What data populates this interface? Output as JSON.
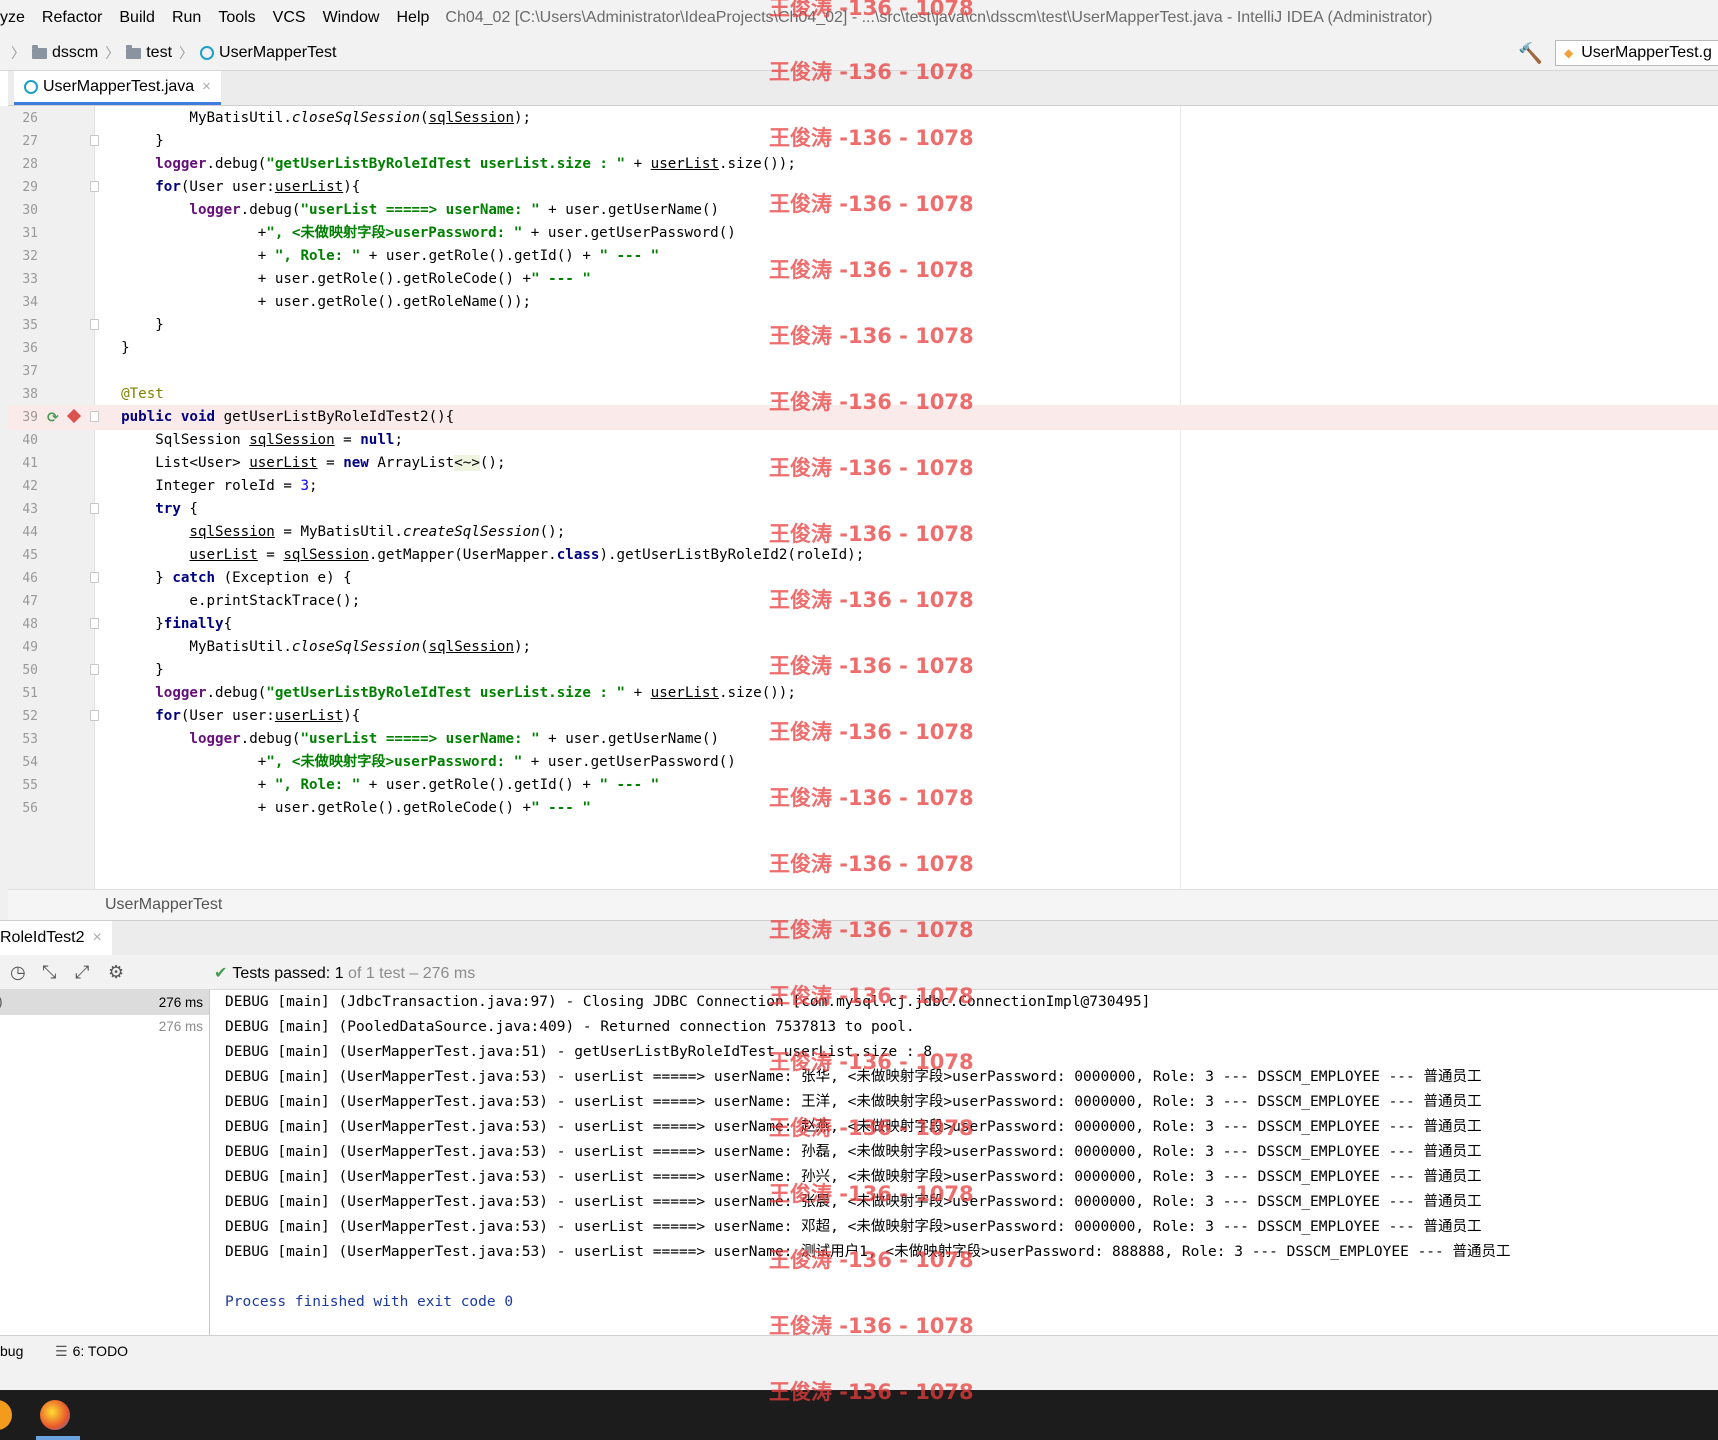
{
  "menu": {
    "items": [
      "yze",
      "Refactor",
      "Build",
      "Run",
      "Tools",
      "VCS",
      "Window",
      "Help"
    ],
    "window_title": "Ch04_02 [C:\\Users\\Administrator\\IdeaProjects\\Ch04_02] - ...\\src\\test\\java\\cn\\dsscm\\test\\UserMapperTest.java - IntelliJ IDEA (Administrator)"
  },
  "nav": {
    "crumbs": [
      "dsscm",
      "test",
      "UserMapperTest"
    ],
    "run_config": "UserMapperTest.g"
  },
  "editor": {
    "tab_label": "UserMapperTest.java",
    "tab_close": "×",
    "breadcrumb": "UserMapperTest",
    "line_numbers": [
      "26",
      "27",
      "28",
      "29",
      "30",
      "31",
      "32",
      "33",
      "34",
      "35",
      "36",
      "37",
      "38",
      "39",
      "40",
      "41",
      "42",
      "43",
      "44",
      "45",
      "46",
      "47",
      "48",
      "49",
      "50",
      "51",
      "52",
      "53",
      "54",
      "55",
      "56"
    ]
  },
  "run": {
    "tab_label": "RoleIdTest2",
    "tab_close": "×",
    "tests_passed_label": "Tests passed:",
    "tests_passed_count": "1",
    "tests_passed_detail": "of 1 test – 276 ms",
    "tree_times": [
      "276 ms",
      "276 ms"
    ],
    "console_lines": [
      "DEBUG [main] (JdbcTransaction.java:97) - Closing JDBC Connection [com.mysql.cj.jdbc.ConnectionImpl@730495]",
      "DEBUG [main] (PooledDataSource.java:409) - Returned connection 7537813 to pool.",
      "DEBUG [main] (UserMapperTest.java:51) - getUserListByRoleIdTest userList.size : 8",
      "DEBUG [main] (UserMapperTest.java:53) - userList =====> userName: 张华, <未做映射字段>userPassword: 0000000, Role: 3 --- DSSCM_EMPLOYEE --- 普通员工",
      "DEBUG [main] (UserMapperTest.java:53) - userList =====> userName: 王洋, <未做映射字段>userPassword: 0000000, Role: 3 --- DSSCM_EMPLOYEE --- 普通员工",
      "DEBUG [main] (UserMapperTest.java:53) - userList =====> userName: 赵燕, <未做映射字段>userPassword: 0000000, Role: 3 --- DSSCM_EMPLOYEE --- 普通员工",
      "DEBUG [main] (UserMapperTest.java:53) - userList =====> userName: 孙磊, <未做映射字段>userPassword: 0000000, Role: 3 --- DSSCM_EMPLOYEE --- 普通员工",
      "DEBUG [main] (UserMapperTest.java:53) - userList =====> userName: 孙兴, <未做映射字段>userPassword: 0000000, Role: 3 --- DSSCM_EMPLOYEE --- 普通员工",
      "DEBUG [main] (UserMapperTest.java:53) - userList =====> userName: 张晨, <未做映射字段>userPassword: 0000000, Role: 3 --- DSSCM_EMPLOYEE --- 普通员工",
      "DEBUG [main] (UserMapperTest.java:53) - userList =====> userName: 邓超, <未做映射字段>userPassword: 0000000, Role: 3 --- DSSCM_EMPLOYEE --- 普通员工",
      "DEBUG [main] (UserMapperTest.java:53) - userList =====> userName: 测试用户1, <未做映射字段>userPassword: 888888, Role: 3 --- DSSCM_EMPLOYEE --- 普通员工",
      "",
      "Process finished with exit code 0"
    ]
  },
  "bottom": {
    "debug_label": "bug",
    "todo_label": "6: TODO"
  },
  "watermark": "王俊涛 -136 - 1078",
  "colors": {
    "keyword": "#000080",
    "string": "#008000",
    "number": "#0000ff",
    "annotation": "#808000",
    "field": "#660e7a",
    "tab_underline": "#3d7de0",
    "passed_green": "#499c54",
    "watermark_red": "#e83c3c"
  }
}
